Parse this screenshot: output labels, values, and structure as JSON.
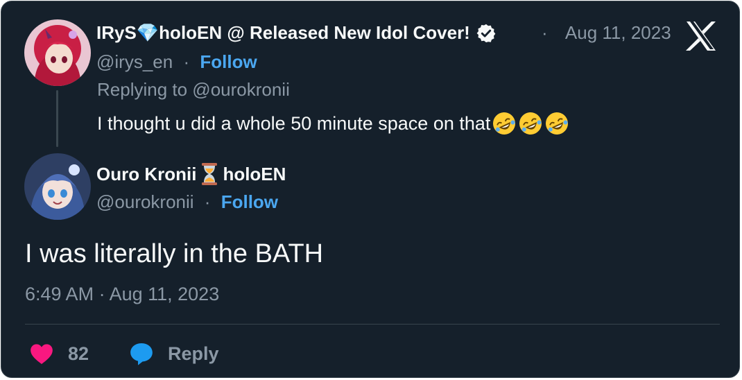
{
  "tweet_parent": {
    "display_name": "IRyS💎holoEN @ Released New Idol Cover!",
    "verified_icon": "verified-badge-icon",
    "date": "Aug 11, 2023",
    "handle": "@irys_en",
    "follow_label": "Follow",
    "replying_to": "Replying to @ourokronii",
    "text": "I thought u did a whole 50 minute space on that",
    "emojis": [
      "rolling-on-floor-laughing-icon",
      "rolling-on-floor-laughing-icon",
      "rolling-on-floor-laughing-icon"
    ]
  },
  "tweet_main": {
    "display_name_part1": "Ouro Kronii",
    "hourglass_icon": "hourglass-icon",
    "display_name_part2": "holoEN",
    "handle": "@ourokronii",
    "follow_label": "Follow",
    "text": "I was literally in the BATH",
    "timestamp": "6:49 AM · Aug 11, 2023"
  },
  "actions": {
    "like_count": "82",
    "reply_label": "Reply"
  },
  "separator": "·",
  "colors": {
    "background": "#15202b",
    "border": "#38444d",
    "text": "#f7f9f9",
    "muted": "#8b98a5",
    "link": "#4ba7f0",
    "like": "#f91880",
    "reply": "#1d9bf0"
  }
}
